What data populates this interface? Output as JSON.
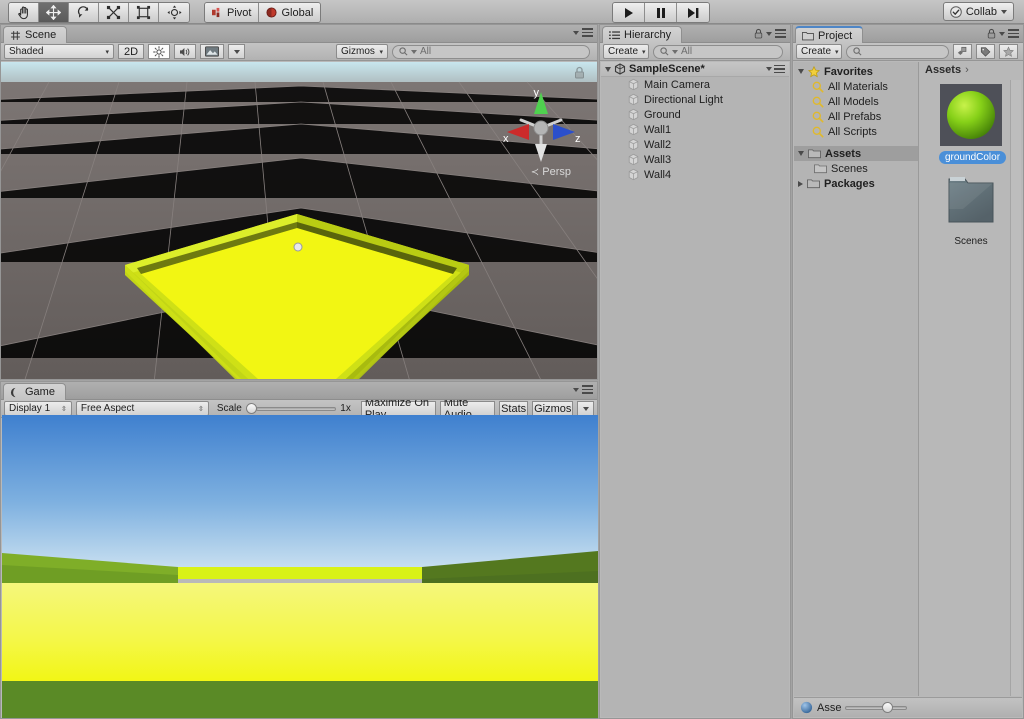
{
  "toolbar": {
    "tools": [
      {
        "name": "hand-tool",
        "icon": "hand",
        "active": false
      },
      {
        "name": "move-tool",
        "icon": "move",
        "active": true
      },
      {
        "name": "rotate-tool",
        "icon": "rotate",
        "active": false
      },
      {
        "name": "scale-tool",
        "icon": "scale",
        "active": false
      },
      {
        "name": "rect-tool",
        "icon": "rect",
        "active": false
      },
      {
        "name": "transform-tool",
        "icon": "transform",
        "active": false
      }
    ],
    "pivot_label": "Pivot",
    "global_label": "Global",
    "play_label": "Play",
    "pause_label": "Pause",
    "step_label": "Step",
    "collab_label": "Collab"
  },
  "scene": {
    "tab_label": "Scene",
    "draw_mode": "Shaded",
    "two_d_label": "2D",
    "gizmos_label": "Gizmos",
    "search_placeholder": "All",
    "perspective_label": "Persp",
    "axis_x": "x",
    "axis_y": "y",
    "axis_z": "z"
  },
  "game": {
    "tab_label": "Game",
    "display": "Display 1",
    "aspect": "Free Aspect",
    "scale_label": "Scale",
    "scale_value": "1x",
    "maximize_label": "Maximize On Play",
    "mute_label": "Mute Audio",
    "stats_label": "Stats",
    "gizmos_label": "Gizmos"
  },
  "hierarchy": {
    "tab_label": "Hierarchy",
    "create_label": "Create",
    "search_placeholder": "All",
    "scene_name": "SampleScene*",
    "objects": [
      {
        "label": "Main Camera"
      },
      {
        "label": "Directional Light"
      },
      {
        "label": "Ground"
      },
      {
        "label": "Wall1"
      },
      {
        "label": "Wall2"
      },
      {
        "label": "Wall3"
      },
      {
        "label": "Wall4"
      }
    ]
  },
  "project": {
    "tab_label": "Project",
    "create_label": "Create",
    "search_placeholder": "",
    "favorites_label": "Favorites",
    "favorites": [
      {
        "label": "All Materials"
      },
      {
        "label": "All Models"
      },
      {
        "label": "All Prefabs"
      },
      {
        "label": "All Scripts"
      }
    ],
    "assets_label": "Assets",
    "scenes_label": "Scenes",
    "packages_label": "Packages",
    "breadcrumb": "Assets",
    "breadcrumb_sep": "›",
    "items": [
      {
        "label": "groundColor",
        "type": "material",
        "selected": true
      },
      {
        "label": "Scenes",
        "type": "folder",
        "selected": false
      }
    ],
    "status_label": "Asse"
  },
  "colors": {
    "material_green": "#8cd418",
    "ground_yellow": "#f2f613",
    "wall_green": "#5a8a26",
    "sky_blue": "#4f8fd6",
    "selection_blue": "#4a8fd8",
    "scene_bg": "#6a6462",
    "accent_red": "#c23a2a"
  }
}
